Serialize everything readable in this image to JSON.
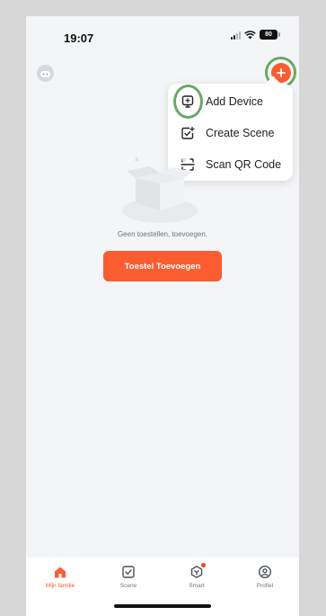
{
  "status_bar": {
    "time": "19:07",
    "battery": "80"
  },
  "header": {
    "avatar_icon": "user-avatar-icon",
    "add_icon": "plus-icon"
  },
  "popup_menu": {
    "items": [
      {
        "label": "Add Device",
        "icon": "add-device-icon"
      },
      {
        "label": "Create Scene",
        "icon": "create-scene-icon"
      },
      {
        "label": "Scan QR Code",
        "icon": "scan-qr-icon"
      }
    ]
  },
  "empty_state": {
    "illustration": "empty-box-icon",
    "message": "Geen toestellen, toevoegen.",
    "button_label": "Toestel Toevoegen"
  },
  "tab_bar": {
    "tabs": [
      {
        "label": "Mijn familie",
        "icon": "home-icon",
        "active": true
      },
      {
        "label": "Scene",
        "icon": "scene-check-icon",
        "active": false
      },
      {
        "label": "Smart",
        "icon": "smart-icon",
        "active": false
      },
      {
        "label": "Profiel",
        "icon": "profile-icon",
        "active": false
      }
    ]
  },
  "colors": {
    "accent": "#fb5c30",
    "highlight_ring": "#6aa866",
    "background": "#f4f5f7"
  }
}
